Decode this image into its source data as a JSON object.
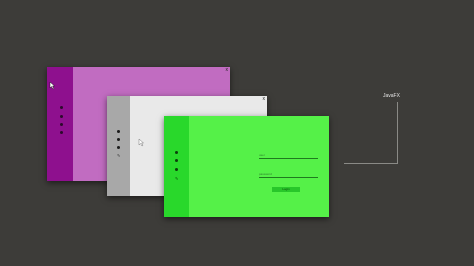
{
  "colors": {
    "background": "#3d3c39",
    "window1_rail": "#8e108e",
    "window1_content": "#c16cc1",
    "window2_rail": "#a8a8a8",
    "window2_content": "#e9e9e9",
    "window3_rail": "#29d82b",
    "window3_content": "#55f148",
    "connector": "#8a8a86"
  },
  "window1": {
    "close_glyph": "x",
    "nav_icons": [
      "dot-icon",
      "dot-icon",
      "dot-icon",
      "dot-icon"
    ]
  },
  "window2": {
    "close_glyph": "x",
    "nav_icons": [
      "dot-icon",
      "dot-icon",
      "dot-icon",
      "pencil-icon"
    ]
  },
  "window3": {
    "close_glyph": "",
    "nav_icons": [
      "dot-icon",
      "dot-icon",
      "dot-icon",
      "pencil-icon"
    ],
    "username": {
      "value": "",
      "placeholder": "user"
    },
    "password": {
      "value": "",
      "placeholder": "password"
    },
    "login_label": "Login"
  },
  "annotation": {
    "label": "JavaFX"
  }
}
